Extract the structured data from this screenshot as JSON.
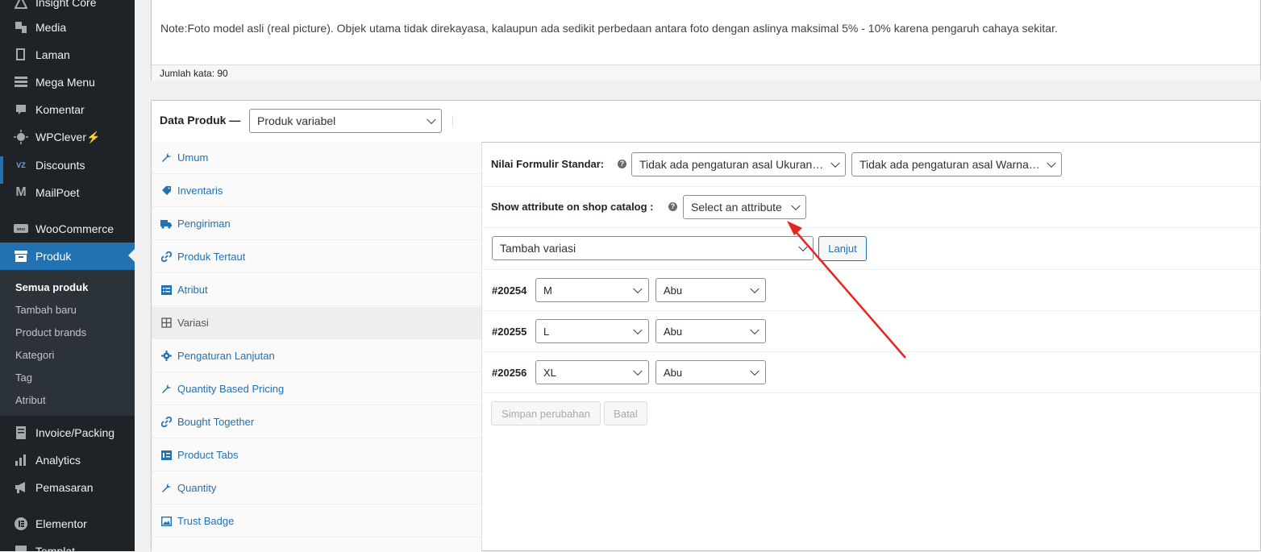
{
  "sidebar": {
    "items": [
      {
        "label": "Insight Core",
        "icon": "insight-icon"
      },
      {
        "label": "Media",
        "icon": "media-icon"
      },
      {
        "label": "Laman",
        "icon": "page-icon"
      },
      {
        "label": "Mega Menu",
        "icon": "menu-icon"
      },
      {
        "label": "Komentar",
        "icon": "comment-icon"
      },
      {
        "label": "WPClever",
        "icon": "wpclever-icon",
        "badge": "⚡"
      },
      {
        "label": "Discounts",
        "icon": "discounts-icon"
      },
      {
        "label": "MailPoet",
        "icon": "mailpoet-icon"
      },
      {
        "label": "WooCommerce",
        "icon": "woocommerce-icon"
      },
      {
        "label": "Produk",
        "icon": "product-icon"
      },
      {
        "label": "Invoice/Packing",
        "icon": "invoice-icon"
      },
      {
        "label": "Analytics",
        "icon": "analytics-icon"
      },
      {
        "label": "Pemasaran",
        "icon": "marketing-icon"
      },
      {
        "label": "Elementor",
        "icon": "elementor-icon"
      },
      {
        "label": "Templat",
        "icon": "template-icon"
      }
    ],
    "submenu": [
      "Semua produk",
      "Tambah baru",
      "Product brands",
      "Kategori",
      "Tag",
      "Atribut"
    ]
  },
  "editor": {
    "note": "Note:Foto model asli (real picture). Objek utama tidak direkayasa, kalaupun ada sedikit perbedaan antara foto dengan aslinya maksimal 5% - 10% karena pengaruh cahaya sekitar.",
    "word_count": "Jumlah kata: 90"
  },
  "product_data": {
    "title": "Data Produk —",
    "type_value": "Produk variabel",
    "tabs": [
      {
        "label": "Umum",
        "icon": "wrench-icon"
      },
      {
        "label": "Inventaris",
        "icon": "tag-icon"
      },
      {
        "label": "Pengiriman",
        "icon": "truck-icon"
      },
      {
        "label": "Produk Tertaut",
        "icon": "link-icon"
      },
      {
        "label": "Atribut",
        "icon": "list-icon"
      },
      {
        "label": "Variasi",
        "icon": "grid-icon"
      },
      {
        "label": "Pengaturan Lanjutan",
        "icon": "gear-icon"
      },
      {
        "label": "Quantity Based Pricing",
        "icon": "wrench-icon"
      },
      {
        "label": "Bought Together",
        "icon": "link-icon"
      },
      {
        "label": "Product Tabs",
        "icon": "tabs-icon"
      },
      {
        "label": "Quantity",
        "icon": "wrench-icon"
      },
      {
        "label": "Trust Badge",
        "icon": "image-icon"
      }
    ],
    "default_form_label": "Nilai Formulir Standar:",
    "default_size": "Tidak ada pengaturan asal Ukuran…",
    "default_color": "Tidak ada pengaturan asal Warna…",
    "catalog_label": "Show attribute on shop catalog :",
    "catalog_select": "Select an attribute",
    "add_variation": "Tambah variasi",
    "go_button": "Lanjut",
    "variations": [
      {
        "id": "#20254",
        "size": "M",
        "color": "Abu"
      },
      {
        "id": "#20255",
        "size": "L",
        "color": "Abu"
      },
      {
        "id": "#20256",
        "size": "XL",
        "color": "Abu"
      }
    ],
    "save_button": "Simpan perubahan",
    "cancel_button": "Batal"
  },
  "colors": {
    "accent": "#2271b1",
    "sidebar": "#1d2327",
    "arrow": "#e8241f"
  }
}
